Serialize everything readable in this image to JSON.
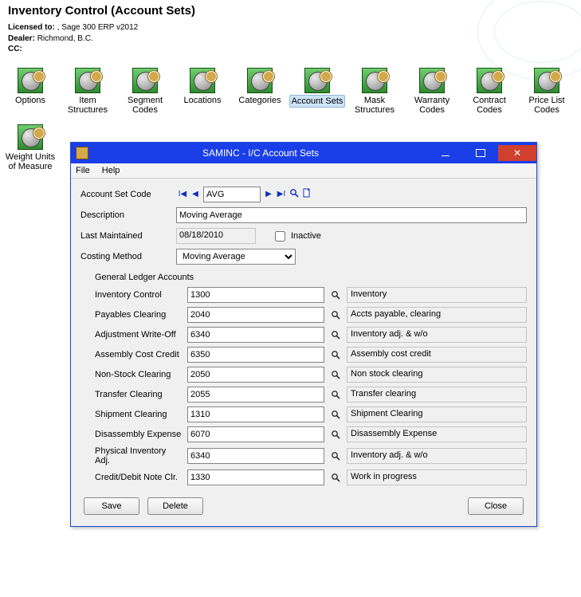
{
  "page": {
    "title": "Inventory Control (Account Sets)",
    "licensed_to_label": "Licensed to:",
    "licensed_to_value": ", Sage 300 ERP v2012",
    "dealer_label": "Dealer:",
    "dealer_value": "Richmond, B.C.",
    "cc_label": "CC:"
  },
  "icons": [
    {
      "label": "Options"
    },
    {
      "label": "Item Structures"
    },
    {
      "label": "Segment Codes"
    },
    {
      "label": "Locations"
    },
    {
      "label": "Categories"
    },
    {
      "label": "Account Sets",
      "selected": true
    },
    {
      "label": "Mask Structures"
    },
    {
      "label": "Warranty Codes"
    },
    {
      "label": "Contract Codes"
    },
    {
      "label": "Price List Codes"
    },
    {
      "label": "Weight Units of Measure"
    }
  ],
  "window": {
    "title": "SAMINC - I/C Account Sets",
    "menu": {
      "file": "File",
      "help": "Help"
    },
    "fields": {
      "code_label": "Account Set Code",
      "code_value": "AVG",
      "desc_label": "Description",
      "desc_value": "Moving Average",
      "lastmaint_label": "Last Maintained",
      "lastmaint_value": "08/18/2010",
      "inactive_label": "Inactive",
      "costing_label": "Costing Method",
      "costing_value": "Moving Average"
    },
    "gl_section_title": "General Ledger Accounts",
    "gl": [
      {
        "label": "Inventory Control",
        "code": "1300",
        "desc": "Inventory"
      },
      {
        "label": "Payables Clearing",
        "code": "2040",
        "desc": "Accts payable, clearing"
      },
      {
        "label": "Adjustment Write-Off",
        "code": "6340",
        "desc": "Inventory adj. & w/o"
      },
      {
        "label": "Assembly Cost Credit",
        "code": "6350",
        "desc": "Assembly cost credit"
      },
      {
        "label": "Non-Stock Clearing",
        "code": "2050",
        "desc": "Non stock clearing"
      },
      {
        "label": "Transfer Clearing",
        "code": "2055",
        "desc": "Transfer clearing"
      },
      {
        "label": "Shipment Clearing",
        "code": "1310",
        "desc": "Shipment Clearing"
      },
      {
        "label": "Disassembly Expense",
        "code": "6070",
        "desc": "Disassembly Expense"
      },
      {
        "label": "Physical Inventory Adj.",
        "code": "6340",
        "desc": "Inventory adj. & w/o"
      },
      {
        "label": "Credit/Debit Note Clr.",
        "code": "1330",
        "desc": "Work in progress"
      }
    ],
    "buttons": {
      "save": "Save",
      "delete": "Delete",
      "close": "Close"
    }
  }
}
